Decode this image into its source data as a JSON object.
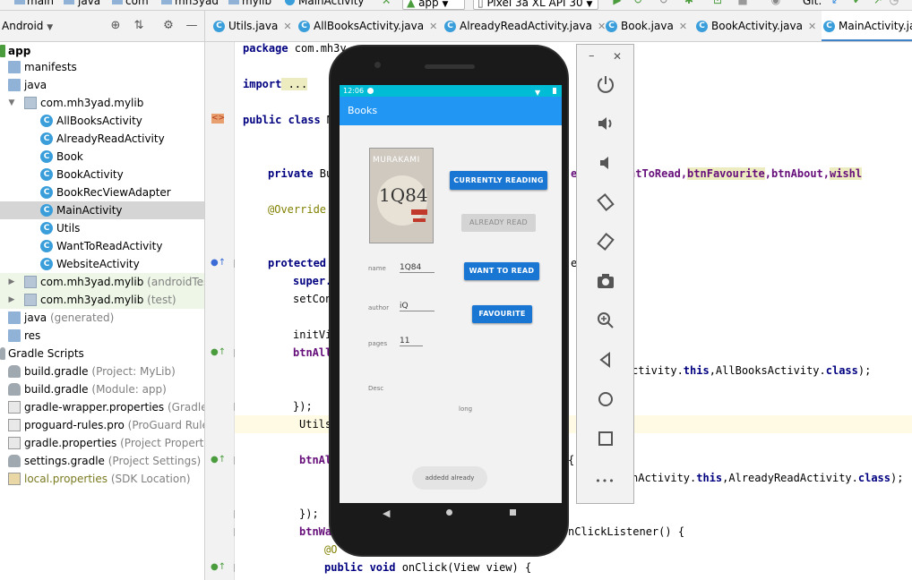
{
  "toolbar": {
    "breadcrumbs": [
      "main",
      "java",
      "com",
      "mh3yad",
      "mylib",
      "MainActivity"
    ],
    "run_config": "app",
    "device": "Pixel 3a XL API 30",
    "git_label": "Git:"
  },
  "project_panel": {
    "view_mode": "Android",
    "tree": [
      {
        "label": "app",
        "bold": true,
        "kind": "folder-app"
      },
      {
        "label": "manifests",
        "kind": "folder"
      },
      {
        "label": "java",
        "kind": "folder"
      },
      {
        "label": "com.mh3yad.mylib",
        "kind": "package",
        "expanded": true
      },
      {
        "label": "AllBooksActivity",
        "kind": "class"
      },
      {
        "label": "AlreadyReadActivity",
        "kind": "class"
      },
      {
        "label": "Book",
        "kind": "class"
      },
      {
        "label": "BookActivity",
        "kind": "class"
      },
      {
        "label": "BookRecViewAdapter",
        "kind": "class"
      },
      {
        "label": "MainActivity",
        "kind": "class",
        "selected": true
      },
      {
        "label": "Utils",
        "kind": "class"
      },
      {
        "label": "WantToReadActivity",
        "kind": "class"
      },
      {
        "label": "WebsiteActivity",
        "kind": "class"
      },
      {
        "label": "com.mh3yad.mylib",
        "suffix": "(androidTest)",
        "kind": "package"
      },
      {
        "label": "com.mh3yad.mylib",
        "suffix": "(test)",
        "kind": "package"
      },
      {
        "label": "java",
        "suffix": "(generated)",
        "kind": "folder"
      },
      {
        "label": "res",
        "kind": "folder"
      },
      {
        "label": "Gradle Scripts",
        "kind": "gradle-root"
      },
      {
        "label": "build.gradle",
        "suffix": "(Project: MyLib)",
        "kind": "gradle"
      },
      {
        "label": "build.gradle",
        "suffix": "(Module: app)",
        "kind": "gradle"
      },
      {
        "label": "gradle-wrapper.properties",
        "suffix": "(Gradle Vers",
        "kind": "file"
      },
      {
        "label": "proguard-rules.pro",
        "suffix": "(ProGuard Rules fo",
        "kind": "file"
      },
      {
        "label": "gradle.properties",
        "suffix": "(Project Properties)",
        "kind": "file"
      },
      {
        "label": "settings.gradle",
        "suffix": "(Project Settings)",
        "kind": "gradle"
      },
      {
        "label": "local.properties",
        "suffix": "(SDK Location)",
        "kind": "file"
      }
    ]
  },
  "editor_tabs": [
    {
      "label": "Utils.java"
    },
    {
      "label": "AllBooksActivity.java"
    },
    {
      "label": "AlreadyReadActivity.java"
    },
    {
      "label": "Book.java"
    },
    {
      "label": "BookActivity.java"
    },
    {
      "label": "MainActivity.java",
      "active": true
    }
  ],
  "code": {
    "l1_kw": "package",
    "l1_rest": " com.mh3y",
    "l2_kw": "import",
    "l2_rest": " ...",
    "l3_kw": "public class",
    "l3_rest": " M",
    "l4_kw": "private",
    "l4_rest": " Bu",
    "l4_right_a": "ead,btnWantToRead,",
    "l4_right_hl": "btnFavourite",
    "l4_right_b": ",btnAbout,",
    "l4_right_hl2": "wishl",
    "l5": "@Override",
    "l6_kw": "protected",
    "l6_right": "e",
    "l7": "super.",
    "l8": "setCon",
    "l9": "initVi",
    "l10": "btnAll",
    "l11_a": "ctivity.",
    "l11_this": "this",
    "l11_b": ",AllBooksActivity.",
    "l11_class": "class",
    "l11_c": ");",
    "l12": "});",
    "l13": "Utils",
    "l14": "btnAl",
    "l14_right": "{",
    "l15_a": "nActivity.",
    "l15_this": "this",
    "l15_b": ",AlreadyReadActivity.",
    "l15_class": "class",
    "l15_c": ");",
    "l16": "});",
    "l17": "btnWa",
    "l17_right": "nClickListener() {",
    "l18": "@O",
    "l19_kw": "public void",
    "l19_rest": " onClick(View view) {"
  },
  "emulator": {
    "status_time": "12:06",
    "app_title": "Books",
    "cover_author": "MURAKAMI",
    "cover_title": "1Q84",
    "btn_currently_reading": "CURRENTLY READING",
    "btn_already_read": "ALREADY READ",
    "btn_want_to_read": "WANT TO READ",
    "btn_favourite": "FAVOURITE",
    "name_label": "name",
    "name_value": "1Q84",
    "author_label": "author",
    "author_value": "iQ",
    "pages_label": "pages",
    "pages_value": "11",
    "desc_label": "Desc",
    "desc_value": "long",
    "toast": "addedd already"
  },
  "emulator_controls": {
    "minimize": "–",
    "close": "✕",
    "more": "•••"
  },
  "colors": {
    "status_bar": "#00bcd4",
    "app_bar": "#2196f3",
    "button_primary": "#1976d2",
    "selection": "#d5d5d5",
    "keyword": "#000080",
    "field": "#660e7a"
  }
}
